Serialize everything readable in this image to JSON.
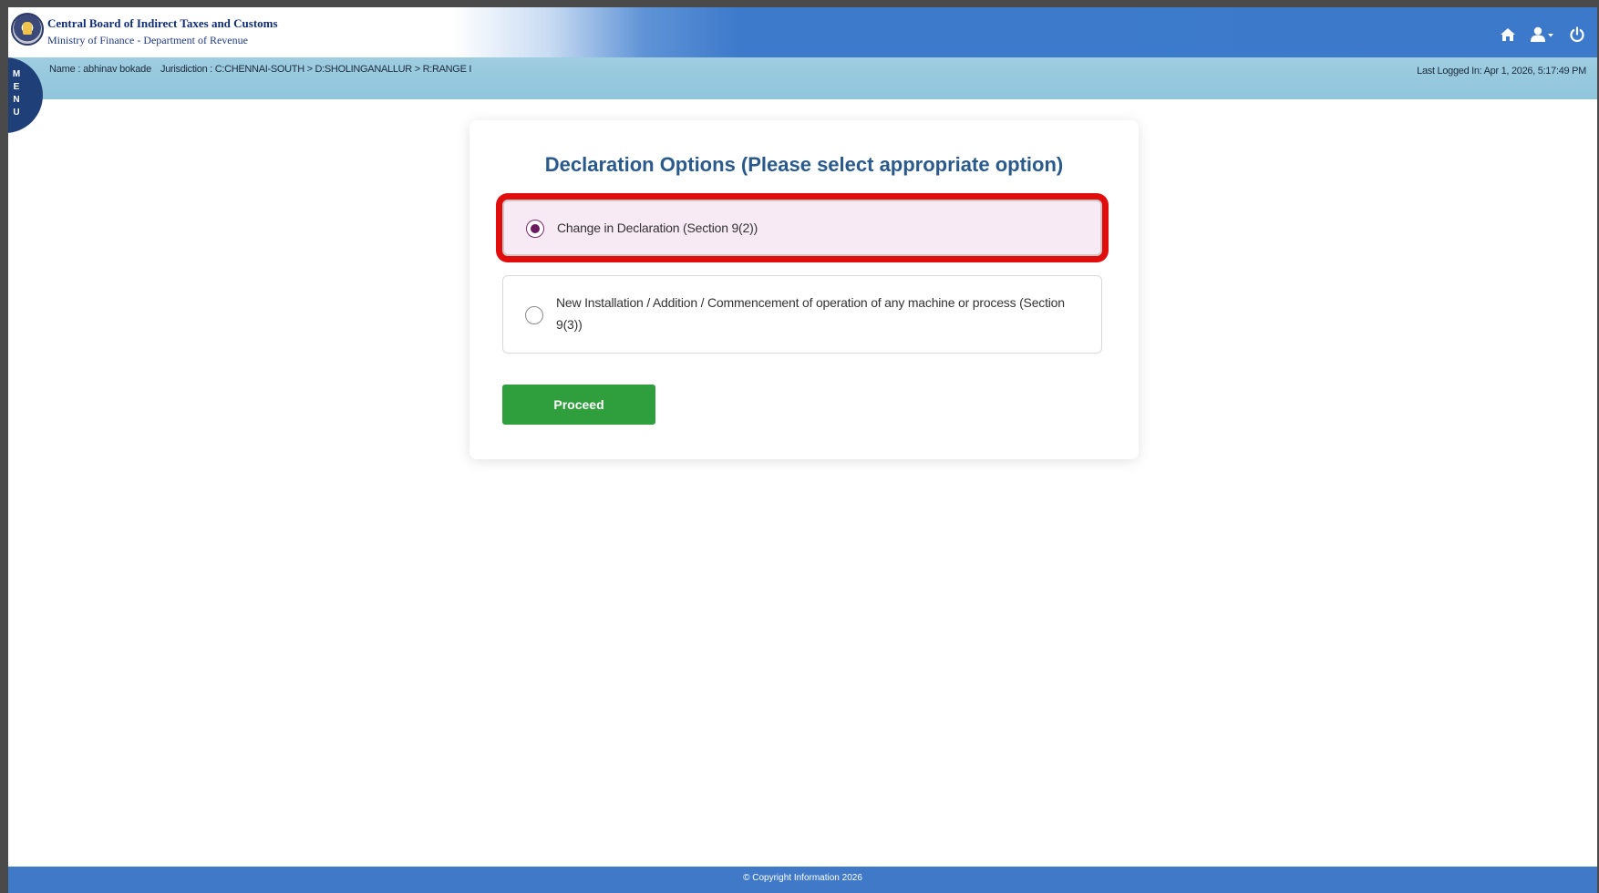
{
  "header": {
    "org_title": "Central Board of Indirect Taxes and Customs",
    "org_subtitle": "Ministry of Finance - Department of Revenue",
    "icons": [
      "home-icon",
      "user-icon",
      "power-icon"
    ],
    "accent_color": "#3c79cb"
  },
  "infobar": {
    "name": "Name : abhinav bokade",
    "jurisdiction": "Jurisdiction : C:CHENNAI-SOUTH > D:SHOLINGANALLUR > R:RANGE I",
    "last_logged": "Last Logged In: Apr 1, 2026, 5:17:49 PM"
  },
  "menu": {
    "label": "MENU"
  },
  "form": {
    "title": "Declaration Options (Please select appropriate option)",
    "options": [
      {
        "label": "Change in Declaration (Section 9(2))",
        "selected": true
      },
      {
        "label": "New Installation / Addition / Commencement of operation of any machine or process (Section 9(3))",
        "selected": false
      }
    ],
    "proceed_label": "Proceed",
    "proceed_color": "#2f9e3d",
    "highlight_color": "#e10d0d"
  },
  "footer": {
    "text": "© Copyright Information 2026"
  }
}
